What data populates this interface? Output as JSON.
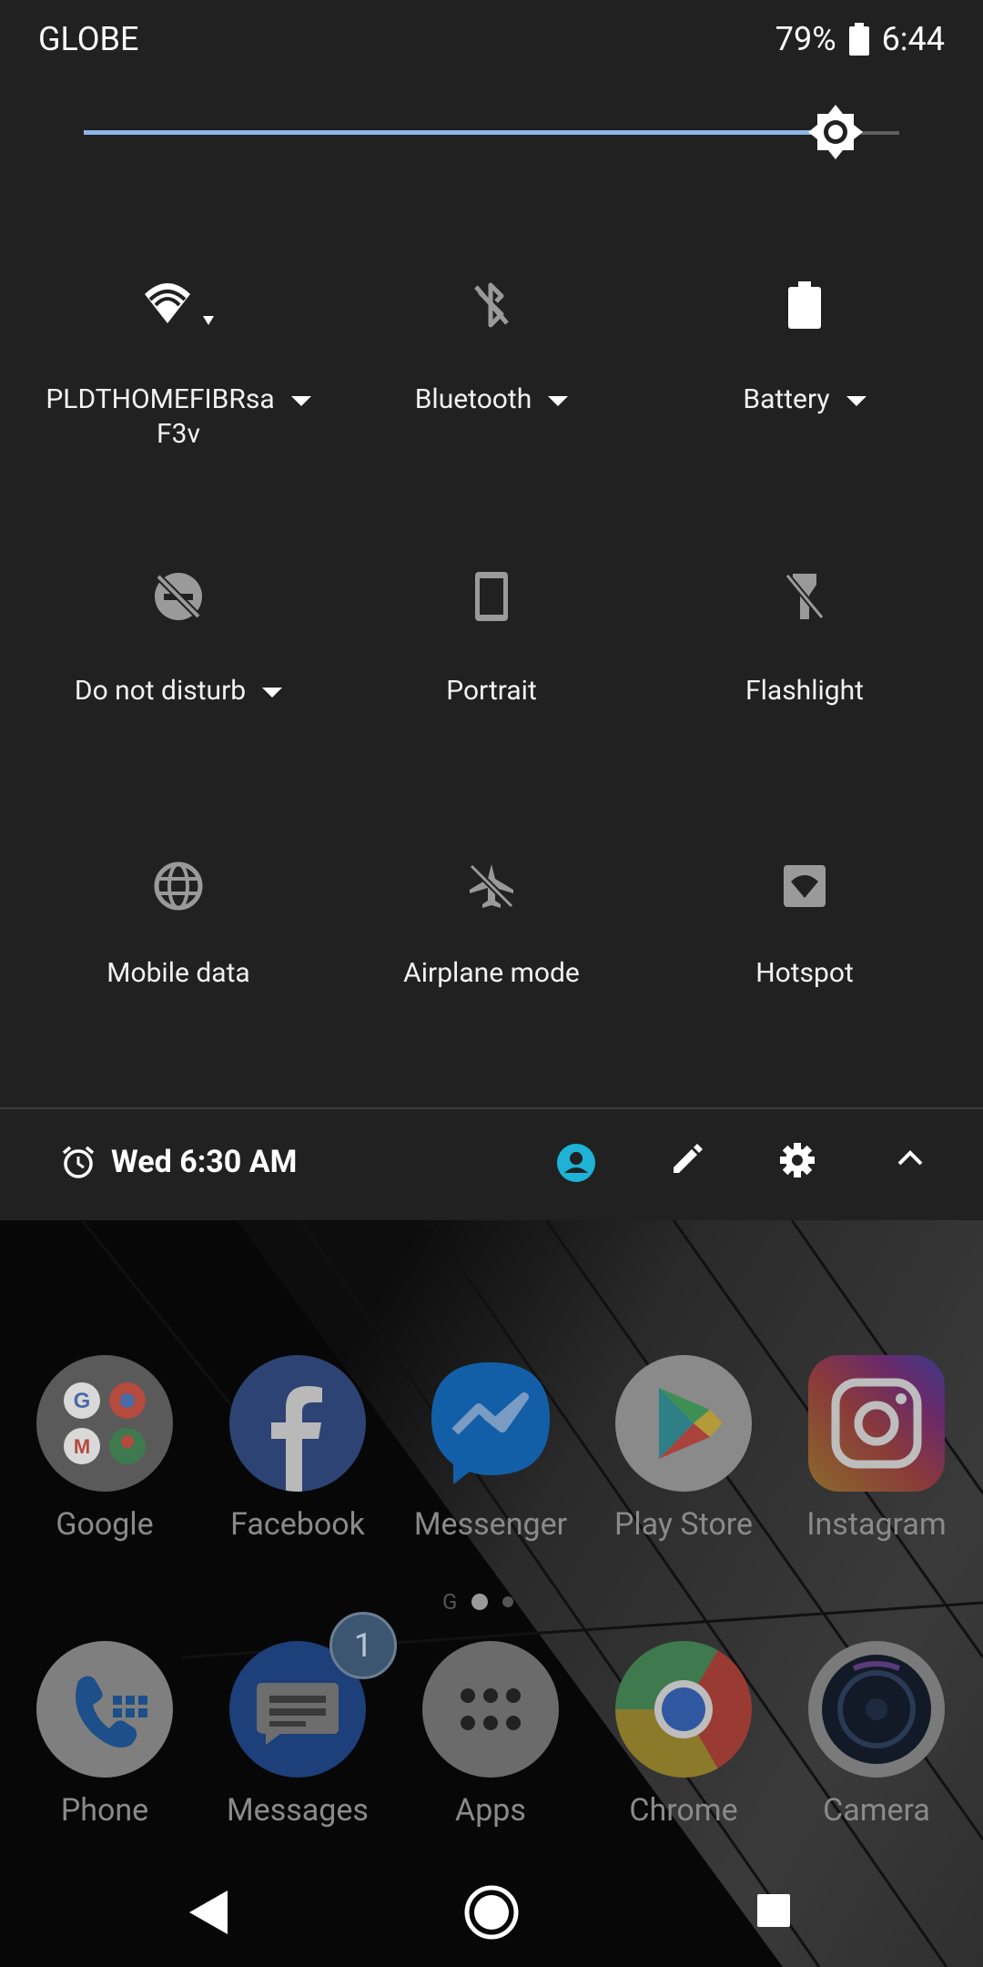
{
  "status_bar": {
    "carrier": "GLOBE",
    "battery_percent": "79%",
    "time": "6:44"
  },
  "brightness": {
    "level": 0.92
  },
  "tiles": [
    {
      "label": "PLDTHOMEFIBRsa",
      "label2": "F3v",
      "icon": "wifi-icon",
      "dropdown": true,
      "state": "on"
    },
    {
      "label": "Bluetooth",
      "icon": "bluetooth-off-icon",
      "dropdown": true,
      "state": "off"
    },
    {
      "label": "Battery",
      "icon": "battery-icon",
      "dropdown": true,
      "state": "on"
    },
    {
      "label": "Do not disturb",
      "icon": "do-not-disturb-off-icon",
      "dropdown": true,
      "state": "off"
    },
    {
      "label": "Portrait",
      "icon": "phone-portrait-icon",
      "dropdown": false,
      "state": "off"
    },
    {
      "label": "Flashlight",
      "icon": "flashlight-off-icon",
      "dropdown": false,
      "state": "off"
    },
    {
      "label": "Mobile data",
      "icon": "globe-icon",
      "dropdown": false,
      "state": "off"
    },
    {
      "label": "Airplane mode",
      "icon": "airplane-off-icon",
      "dropdown": false,
      "state": "off"
    },
    {
      "label": "Hotspot",
      "icon": "hotspot-icon",
      "dropdown": false,
      "state": "off"
    }
  ],
  "footer": {
    "alarm_text": "Wed 6:30 AM",
    "accent": "#1eb3d6"
  },
  "home": {
    "row1": [
      {
        "label": "Google",
        "icon": "google-folder-icon"
      },
      {
        "label": "Facebook",
        "icon": "facebook-icon"
      },
      {
        "label": "Messenger",
        "icon": "messenger-icon"
      },
      {
        "label": "Play Store",
        "icon": "play-store-icon"
      },
      {
        "label": "Instagram",
        "icon": "instagram-icon"
      }
    ],
    "dock": [
      {
        "label": "Phone",
        "icon": "phone-icon"
      },
      {
        "label": "Messages",
        "icon": "messages-icon",
        "badge": "1"
      },
      {
        "label": "Apps",
        "icon": "apps-icon"
      },
      {
        "label": "Chrome",
        "icon": "chrome-icon"
      },
      {
        "label": "Camera",
        "icon": "camera-icon"
      }
    ]
  }
}
